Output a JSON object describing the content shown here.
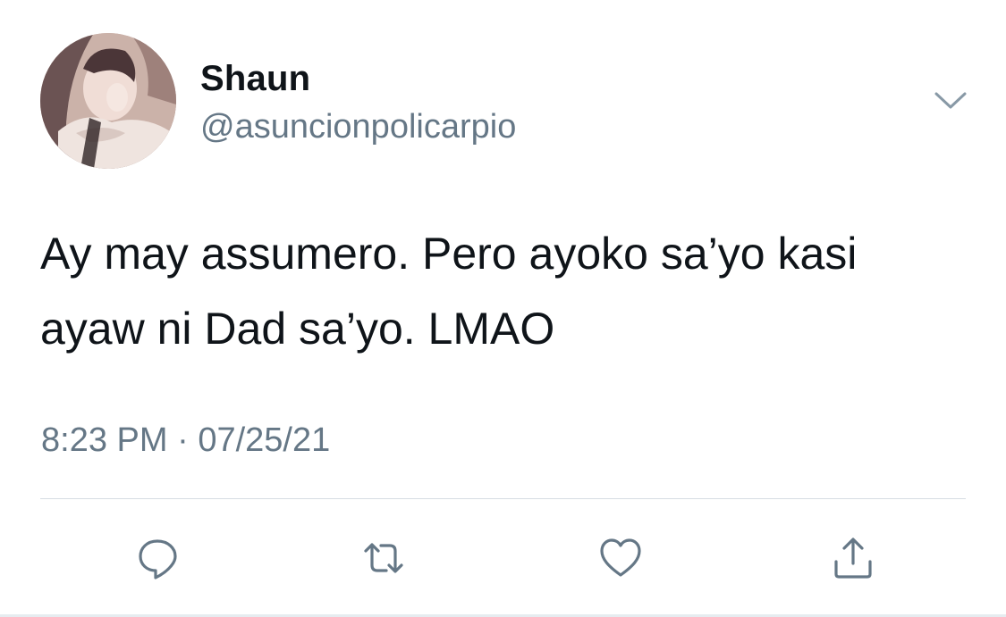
{
  "tweet": {
    "author": {
      "display_name": "Shaun",
      "handle": "@asuncionpolicarpio",
      "avatar_icon": "profile-photo"
    },
    "text": "Ay may assumero. Pero ayoko sa’yo kasi ayaw ni Dad sa’yo. LMAO",
    "time": "8:23 PM",
    "separator": "·",
    "date": "07/25/21",
    "menu_icon": "chevron-down-icon",
    "actions": [
      {
        "name": "reply",
        "icon": "speech-bubble-icon"
      },
      {
        "name": "retweet",
        "icon": "retweet-arrows-icon"
      },
      {
        "name": "like",
        "icon": "heart-icon"
      },
      {
        "name": "share",
        "icon": "share-upload-icon"
      }
    ]
  },
  "colors": {
    "text_primary": "#0f1419",
    "text_secondary": "#657786",
    "icon_gray": "#657786",
    "divider": "#d6dde3"
  }
}
